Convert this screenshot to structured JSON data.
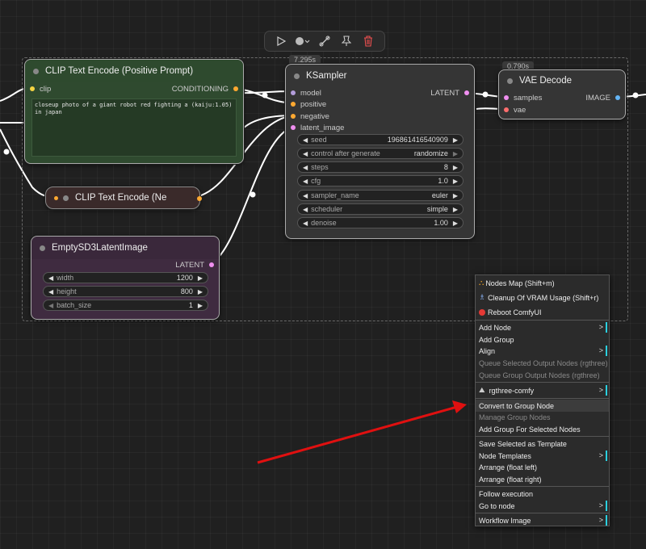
{
  "toolbar": {
    "items": [
      "play-icon",
      "color-icon",
      "bypass-icon",
      "pin-icon",
      "delete-icon"
    ]
  },
  "nodes": {
    "clip_positive": {
      "title": "CLIP Text Encode (Positive Prompt)",
      "input_clip": "clip",
      "output": "CONDITIONING",
      "text": "closeup photo of a giant robot red fighting a (kaiju:1.05) in japan"
    },
    "clip_negative": {
      "title": "CLIP Text Encode (Ne"
    },
    "ksampler": {
      "timing": "7.295s",
      "title": "KSampler",
      "inputs": [
        "model",
        "positive",
        "negative",
        "latent_image"
      ],
      "output": "LATENT",
      "widgets": [
        {
          "label": "seed",
          "value": "196861416540909"
        },
        {
          "label": "control after generate",
          "value": "randomize"
        },
        {
          "label": "steps",
          "value": "8"
        },
        {
          "label": "cfg",
          "value": "1.0"
        },
        {
          "label": "sampler_name",
          "value": "euler"
        },
        {
          "label": "scheduler",
          "value": "simple"
        },
        {
          "label": "denoise",
          "value": "1.00"
        }
      ]
    },
    "vae_decode": {
      "timing": "0.790s",
      "title": "VAE Decode",
      "inputs": [
        "samples",
        "vae"
      ],
      "output": "IMAGE"
    },
    "empty_latent": {
      "title": "EmptySD3LatentImage",
      "output": "LATENT",
      "widgets": [
        {
          "label": "width",
          "value": "1200"
        },
        {
          "label": "height",
          "value": "800"
        },
        {
          "label": "batch_size",
          "value": "1"
        }
      ]
    }
  },
  "context_menu": {
    "items": [
      {
        "label": "Nodes Map (Shift+m)",
        "icon": "sitemap-icon"
      },
      {
        "label": "Cleanup Of VRAM Usage (Shift+r)",
        "icon": "broom-icon"
      },
      {
        "label": "Reboot ComfyUI",
        "icon": "power-icon"
      },
      {
        "label": "Add Node",
        "submenu": true
      },
      {
        "label": "Add Group"
      },
      {
        "label": "Align",
        "submenu": true
      },
      {
        "label": "Queue Selected Output Nodes (rgthree)",
        "disabled": true
      },
      {
        "label": "Queue Group Output Nodes (rgthree)",
        "disabled": true
      },
      {
        "label": "rgthree-comfy",
        "icon": "rgthree-icon",
        "submenu": true
      },
      {
        "label": "Convert to Group Node",
        "highlighted": true
      },
      {
        "label": "Manage Group Nodes",
        "disabled": true
      },
      {
        "label": "Add Group For Selected Nodes"
      },
      {
        "label": "Save Selected as Template"
      },
      {
        "label": "Node Templates",
        "submenu": true
      },
      {
        "label": "Arrange (float left)"
      },
      {
        "label": "Arrange (float right)"
      },
      {
        "label": "Follow execution"
      },
      {
        "label": "Go to node",
        "submenu": true
      },
      {
        "label": "Workflow Image",
        "submenu": true
      }
    ],
    "submenu_glyph": ">"
  },
  "colors": {
    "clip_port": "#f5d442",
    "conditioning_port": "#ffa931",
    "latent_port": "#f08ff0",
    "vae_port": "#ff6e6e",
    "image_port": "#64b5f6",
    "model_port": "#b39ddb",
    "annotation_arrow": "#e01010",
    "submenu_accent": "#2ad0e0"
  }
}
